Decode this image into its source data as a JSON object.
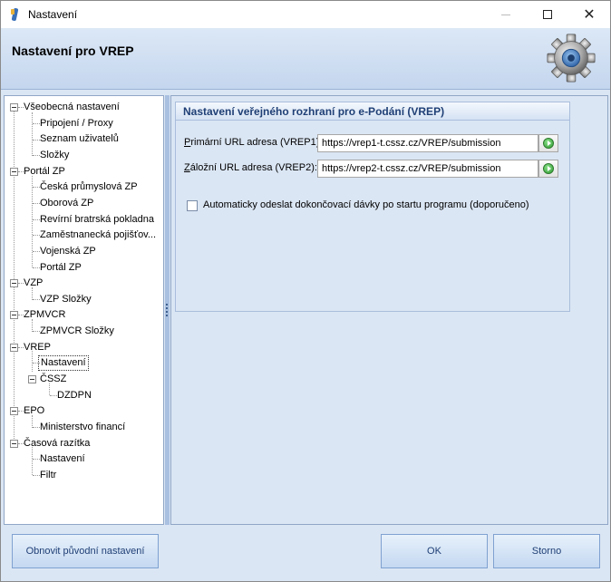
{
  "window": {
    "title": "Nastavení"
  },
  "header": {
    "title": "Nastavení pro VREP"
  },
  "tree": [
    {
      "label": "Všeobecná nastavení"
    },
    {
      "label": "Pripojení / Proxy"
    },
    {
      "label": "Seznam uživatelů"
    },
    {
      "label": "Složky"
    },
    {
      "label": "Portál ZP"
    },
    {
      "label": "Česká průmyslová ZP"
    },
    {
      "label": "Oborová ZP"
    },
    {
      "label": "Revírní bratrská pokladna"
    },
    {
      "label": "Zaměstnanecká pojišťov..."
    },
    {
      "label": "Vojenská ZP"
    },
    {
      "label": "Portál ZP"
    },
    {
      "label": "VZP"
    },
    {
      "label": "VZP Složky"
    },
    {
      "label": "ZPMVCR"
    },
    {
      "label": "ZPMVCR Složky"
    },
    {
      "label": "VREP"
    },
    {
      "label": "Nastavení"
    },
    {
      "label": "ČSSZ"
    },
    {
      "label": "DZDPN"
    },
    {
      "label": "EPO"
    },
    {
      "label": "Ministerstvo financí"
    },
    {
      "label": "Časová razítka"
    },
    {
      "label": "Nastavení"
    },
    {
      "label": "Filtr"
    }
  ],
  "group": {
    "title": "Nastavení veřejného rozhraní pro e-Podání (VREP)",
    "primary": {
      "label_accel": "P",
      "label_rest": "rimární URL adresa (VREP1):",
      "value": "https://vrep1-t.cssz.cz/VREP/submission"
    },
    "backup": {
      "label_accel": "Z",
      "label_rest": "áložní URL adresa (VREP2):",
      "value": "https://vrep2-t.cssz.cz/VREP/submission"
    },
    "auto_send_label": "Automaticky odeslat dokončovací dávky po startu programu (doporučeno)"
  },
  "buttons": {
    "restore": "Obnovit původní nastavení",
    "ok": "OK",
    "cancel": "Storno"
  },
  "icons": {
    "app": "app-icon",
    "header": "gear-icon",
    "go": "go-icon"
  }
}
